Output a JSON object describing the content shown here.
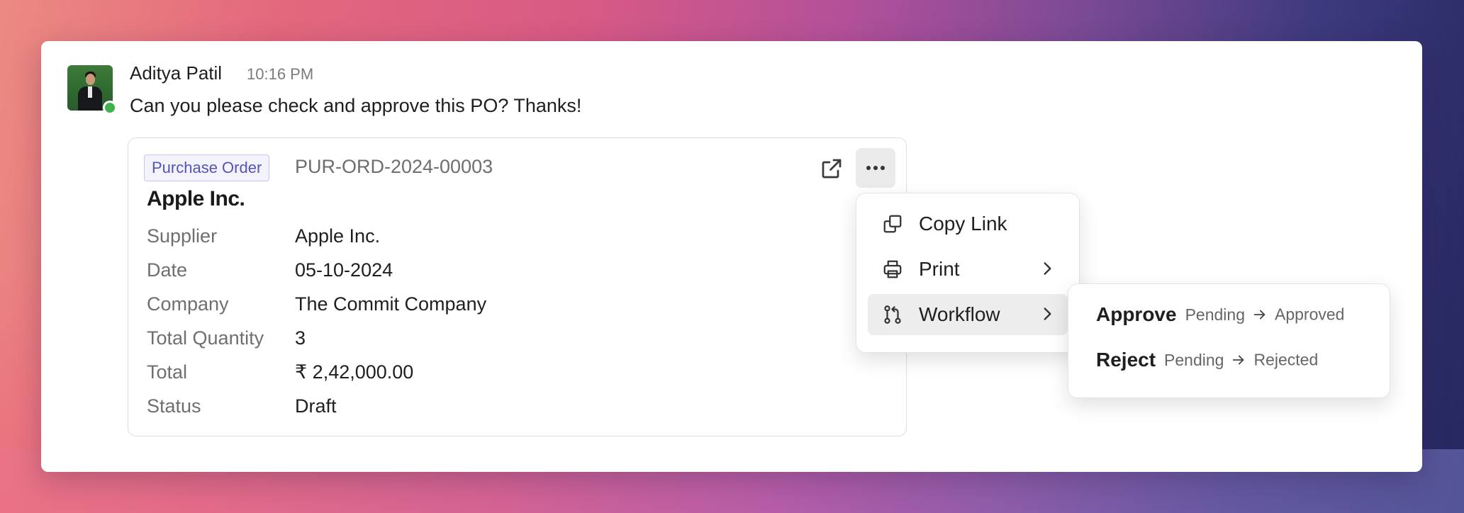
{
  "message": {
    "author": "Aditya Patil",
    "time": "10:16 PM",
    "text": "Can you please check and approve this PO? Thanks!",
    "presence_color": "#3fb24e"
  },
  "document": {
    "type_badge": "Purchase Order",
    "id": "PUR-ORD-2024-00003",
    "title": "Apple Inc.",
    "fields": [
      {
        "label": "Supplier",
        "value": "Apple Inc."
      },
      {
        "label": "Date",
        "value": "05-10-2024"
      },
      {
        "label": "Company",
        "value": "The Commit Company"
      },
      {
        "label": "Total Quantity",
        "value": "3"
      },
      {
        "label": "Total",
        "value": "₹ 2,42,000.00"
      },
      {
        "label": "Status",
        "value": "Draft"
      }
    ],
    "icons": {
      "open": "external-link-icon",
      "more": "more-horizontal-icon"
    }
  },
  "menu": {
    "items": [
      {
        "label": "Copy Link",
        "icon": "copy-icon",
        "has_submenu": false
      },
      {
        "label": "Print",
        "icon": "printer-icon",
        "has_submenu": true
      },
      {
        "label": "Workflow",
        "icon": "git-pull-request-icon",
        "has_submenu": true,
        "active": true
      }
    ]
  },
  "workflow_submenu": {
    "actions": [
      {
        "action": "Approve",
        "from": "Pending",
        "to": "Approved"
      },
      {
        "action": "Reject",
        "from": "Pending",
        "to": "Rejected"
      }
    ]
  },
  "colors": {
    "badge_text": "#5653b8",
    "badge_border": "#c7c6f0",
    "active_menu_bg": "#ededed"
  }
}
